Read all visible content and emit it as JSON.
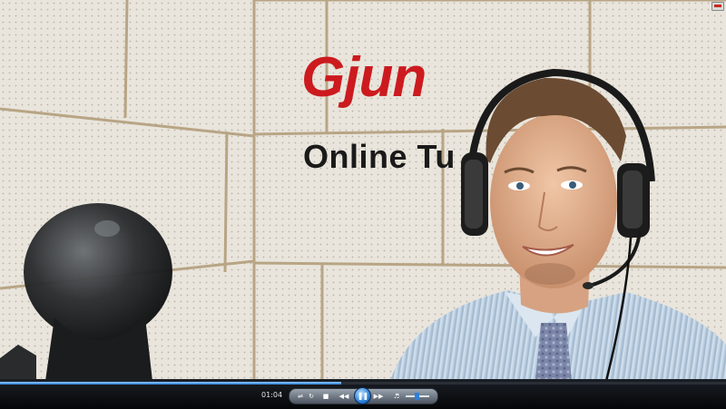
{
  "player": {
    "playback_time": "01:04",
    "progress_fraction": 0.47,
    "accent_color": "#2f7fd6"
  },
  "video": {
    "logo_brand": "Gjun",
    "logo_tagline": "Online Tu"
  },
  "icons": {
    "window_button": "restore-window-icon",
    "shuffle": "shuffle-icon",
    "repeat": "repeat-icon",
    "stop": "stop-icon",
    "previous": "previous-icon",
    "play_pause": "pause-icon",
    "next": "next-icon",
    "mute": "speaker-icon",
    "volume": "volume-slider"
  }
}
